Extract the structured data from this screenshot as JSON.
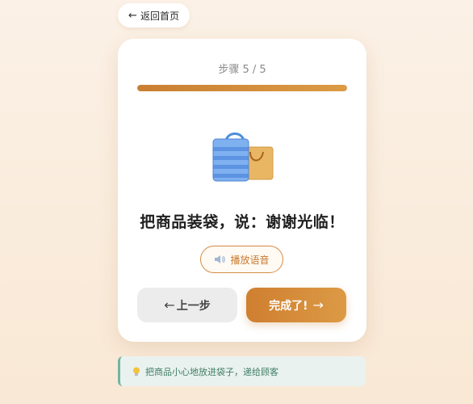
{
  "back_button": {
    "label": "返回首页",
    "arrow": "←"
  },
  "card": {
    "step_indicator": "步骤 5 / 5",
    "progress": 1.0,
    "illustration": "shopping-bags-icon",
    "instruction": "把商品装袋，说：谢谢光临！",
    "audio_button": {
      "label": "播放语音",
      "icon": "speaker-icon"
    },
    "prev_button": {
      "label": "上一步",
      "arrow": "←"
    },
    "next_button": {
      "label": "完成了!",
      "arrow": "→"
    }
  },
  "tip": {
    "icon": "lightbulb-icon",
    "text": "把商品小心地放进袋子，递给顾客"
  },
  "colors": {
    "accent": "#d48c45",
    "tip_border": "#74b59e",
    "tip_text": "#3f7d66"
  }
}
